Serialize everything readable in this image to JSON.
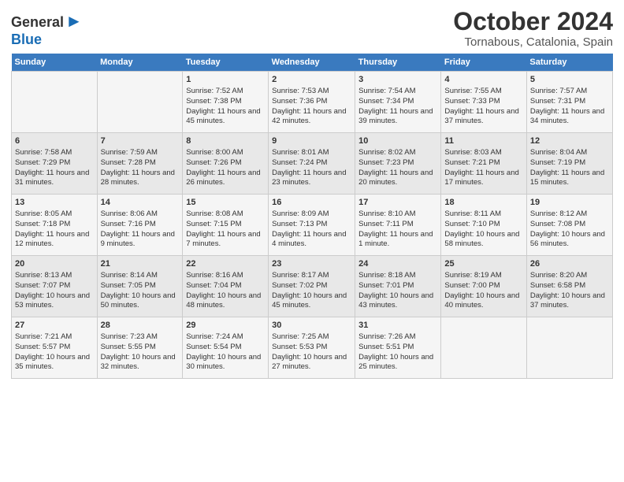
{
  "header": {
    "logo_general": "General",
    "logo_blue": "Blue",
    "month": "October 2024",
    "location": "Tornabous, Catalonia, Spain"
  },
  "weekdays": [
    "Sunday",
    "Monday",
    "Tuesday",
    "Wednesday",
    "Thursday",
    "Friday",
    "Saturday"
  ],
  "weeks": [
    [
      {
        "day": "",
        "content": ""
      },
      {
        "day": "",
        "content": ""
      },
      {
        "day": "1",
        "content": "Sunrise: 7:52 AM\nSunset: 7:38 PM\nDaylight: 11 hours and 45 minutes."
      },
      {
        "day": "2",
        "content": "Sunrise: 7:53 AM\nSunset: 7:36 PM\nDaylight: 11 hours and 42 minutes."
      },
      {
        "day": "3",
        "content": "Sunrise: 7:54 AM\nSunset: 7:34 PM\nDaylight: 11 hours and 39 minutes."
      },
      {
        "day": "4",
        "content": "Sunrise: 7:55 AM\nSunset: 7:33 PM\nDaylight: 11 hours and 37 minutes."
      },
      {
        "day": "5",
        "content": "Sunrise: 7:57 AM\nSunset: 7:31 PM\nDaylight: 11 hours and 34 minutes."
      }
    ],
    [
      {
        "day": "6",
        "content": "Sunrise: 7:58 AM\nSunset: 7:29 PM\nDaylight: 11 hours and 31 minutes."
      },
      {
        "day": "7",
        "content": "Sunrise: 7:59 AM\nSunset: 7:28 PM\nDaylight: 11 hours and 28 minutes."
      },
      {
        "day": "8",
        "content": "Sunrise: 8:00 AM\nSunset: 7:26 PM\nDaylight: 11 hours and 26 minutes."
      },
      {
        "day": "9",
        "content": "Sunrise: 8:01 AM\nSunset: 7:24 PM\nDaylight: 11 hours and 23 minutes."
      },
      {
        "day": "10",
        "content": "Sunrise: 8:02 AM\nSunset: 7:23 PM\nDaylight: 11 hours and 20 minutes."
      },
      {
        "day": "11",
        "content": "Sunrise: 8:03 AM\nSunset: 7:21 PM\nDaylight: 11 hours and 17 minutes."
      },
      {
        "day": "12",
        "content": "Sunrise: 8:04 AM\nSunset: 7:19 PM\nDaylight: 11 hours and 15 minutes."
      }
    ],
    [
      {
        "day": "13",
        "content": "Sunrise: 8:05 AM\nSunset: 7:18 PM\nDaylight: 11 hours and 12 minutes."
      },
      {
        "day": "14",
        "content": "Sunrise: 8:06 AM\nSunset: 7:16 PM\nDaylight: 11 hours and 9 minutes."
      },
      {
        "day": "15",
        "content": "Sunrise: 8:08 AM\nSunset: 7:15 PM\nDaylight: 11 hours and 7 minutes."
      },
      {
        "day": "16",
        "content": "Sunrise: 8:09 AM\nSunset: 7:13 PM\nDaylight: 11 hours and 4 minutes."
      },
      {
        "day": "17",
        "content": "Sunrise: 8:10 AM\nSunset: 7:11 PM\nDaylight: 11 hours and 1 minute."
      },
      {
        "day": "18",
        "content": "Sunrise: 8:11 AM\nSunset: 7:10 PM\nDaylight: 10 hours and 58 minutes."
      },
      {
        "day": "19",
        "content": "Sunrise: 8:12 AM\nSunset: 7:08 PM\nDaylight: 10 hours and 56 minutes."
      }
    ],
    [
      {
        "day": "20",
        "content": "Sunrise: 8:13 AM\nSunset: 7:07 PM\nDaylight: 10 hours and 53 minutes."
      },
      {
        "day": "21",
        "content": "Sunrise: 8:14 AM\nSunset: 7:05 PM\nDaylight: 10 hours and 50 minutes."
      },
      {
        "day": "22",
        "content": "Sunrise: 8:16 AM\nSunset: 7:04 PM\nDaylight: 10 hours and 48 minutes."
      },
      {
        "day": "23",
        "content": "Sunrise: 8:17 AM\nSunset: 7:02 PM\nDaylight: 10 hours and 45 minutes."
      },
      {
        "day": "24",
        "content": "Sunrise: 8:18 AM\nSunset: 7:01 PM\nDaylight: 10 hours and 43 minutes."
      },
      {
        "day": "25",
        "content": "Sunrise: 8:19 AM\nSunset: 7:00 PM\nDaylight: 10 hours and 40 minutes."
      },
      {
        "day": "26",
        "content": "Sunrise: 8:20 AM\nSunset: 6:58 PM\nDaylight: 10 hours and 37 minutes."
      }
    ],
    [
      {
        "day": "27",
        "content": "Sunrise: 7:21 AM\nSunset: 5:57 PM\nDaylight: 10 hours and 35 minutes."
      },
      {
        "day": "28",
        "content": "Sunrise: 7:23 AM\nSunset: 5:55 PM\nDaylight: 10 hours and 32 minutes."
      },
      {
        "day": "29",
        "content": "Sunrise: 7:24 AM\nSunset: 5:54 PM\nDaylight: 10 hours and 30 minutes."
      },
      {
        "day": "30",
        "content": "Sunrise: 7:25 AM\nSunset: 5:53 PM\nDaylight: 10 hours and 27 minutes."
      },
      {
        "day": "31",
        "content": "Sunrise: 7:26 AM\nSunset: 5:51 PM\nDaylight: 10 hours and 25 minutes."
      },
      {
        "day": "",
        "content": ""
      },
      {
        "day": "",
        "content": ""
      }
    ]
  ]
}
